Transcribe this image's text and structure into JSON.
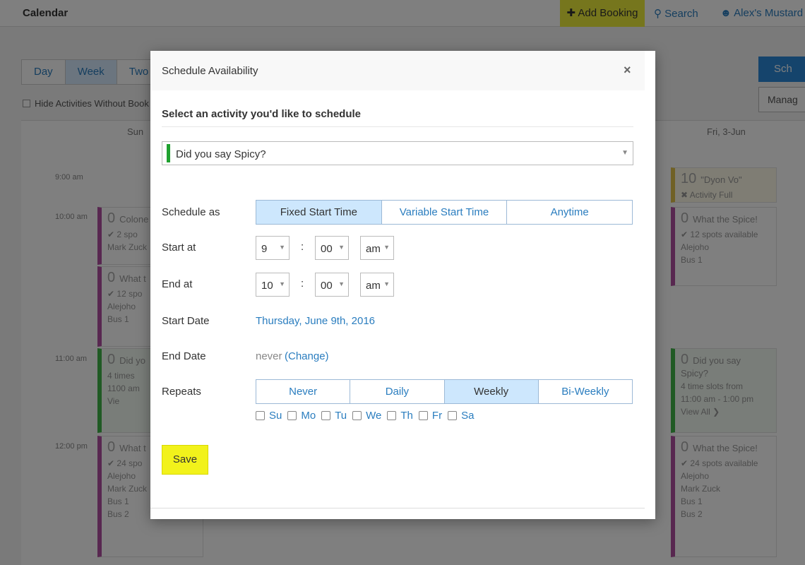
{
  "app": {
    "title": "Calendar",
    "add_booking": "✚ Add Booking",
    "search": "Search",
    "user": "Alex's Mustard"
  },
  "view_tabs": [
    "Day",
    "Week",
    "Two"
  ],
  "hide_activities_label": "Hide Activities Without Book",
  "right_buttons": {
    "schedule": "Sch",
    "manage": "Manag"
  },
  "calendar": {
    "day_headers": [
      "Sun",
      "Fri, 3-Jun"
    ],
    "times": [
      "9:00 am",
      "10:00 am",
      "11:00 am",
      "12:00 pm"
    ],
    "cards": [
      {
        "count": "0",
        "title": "Colone",
        "line1": "✔ 2 spo",
        "line2": "Mark Zuck"
      },
      {
        "count": "0",
        "title": "What t",
        "line1": "✔ 12 spo",
        "line2": "Alejoho",
        "line3": "Bus 1"
      },
      {
        "count": "0",
        "title": "Did yo",
        "line1": "4 times",
        "line2": "1100 am",
        "line3": "Vie"
      },
      {
        "count": "0",
        "title": "What t",
        "line1": "✔ 24 spo",
        "line2": "Alejoho",
        "line3": "Mark Zuck",
        "line4": "Bus 1",
        "line5": "Bus 2"
      },
      {
        "count": "10",
        "title": "\"Dyon Vo\"",
        "line1": "✖ Activity Full"
      },
      {
        "count": "0",
        "title": "What the Spice!",
        "line1": "✔ 12 spots available",
        "line2": "Alejoho",
        "line3": "Bus 1"
      },
      {
        "count": "0",
        "title": "Did you say Spicy?",
        "line1": "4 time slots from",
        "line2": "11:00 am - 1:00 pm",
        "line3": "View All ❯"
      },
      {
        "count": "0",
        "title": "What the Spice!",
        "line1": "✔ 24 spots available",
        "line2": "Alejoho",
        "line3": "Mark Zuck",
        "line4": "Bus 1",
        "line5": "Bus 2"
      }
    ]
  },
  "modal": {
    "title": "Schedule Availability",
    "close": "×",
    "section_title": "Select an activity you'd like to schedule",
    "activity": {
      "value": "Did you say Spicy?",
      "color": "#1fa12f"
    },
    "schedule_as": {
      "label": "Schedule as",
      "options": [
        "Fixed Start Time",
        "Variable Start Time",
        "Anytime"
      ],
      "selected": "Fixed Start Time"
    },
    "start_at": {
      "label": "Start at",
      "hour": "9",
      "minute": "00",
      "ampm": "am"
    },
    "end_at": {
      "label": "End at",
      "hour": "10",
      "minute": "00",
      "ampm": "am"
    },
    "separator": ":",
    "start_date": {
      "label": "Start Date",
      "value": "Thursday, June 9th, 2016"
    },
    "end_date": {
      "label": "End Date",
      "value": "never",
      "change_link": "(Change)"
    },
    "repeats": {
      "label": "Repeats",
      "options": [
        "Never",
        "Daily",
        "Weekly",
        "Bi-Weekly"
      ],
      "selected": "Weekly"
    },
    "days": [
      "Su",
      "Mo",
      "Tu",
      "We",
      "Th",
      "Fr",
      "Sa"
    ],
    "save": "Save"
  },
  "colors": {
    "accent_blue": "#2a7dbf",
    "selected_segment": "#cde7fd",
    "save_yellow": "#f2f21b",
    "activity_green": "#1fa12f"
  }
}
